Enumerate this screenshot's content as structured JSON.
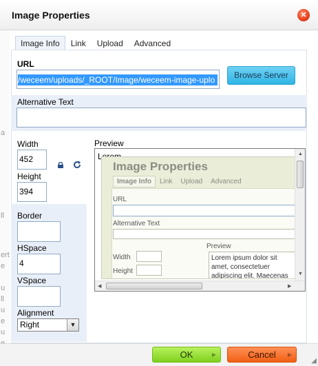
{
  "background_page": {
    "fragments": [
      "a",
      "ll",
      "ert",
      "e",
      "u",
      "ll",
      "u",
      "e",
      "u",
      "e",
      "a"
    ]
  },
  "dialog": {
    "title": "Image Properties",
    "close_icon": "close-icon"
  },
  "tabs": [
    {
      "label": "Image Info",
      "active": true
    },
    {
      "label": "Link",
      "active": false
    },
    {
      "label": "Upload",
      "active": false
    },
    {
      "label": "Advanced",
      "active": false
    }
  ],
  "form": {
    "url_label": "URL",
    "url_value": "/weceem/uploads/_ROOT/Image/weceem-image-uplo",
    "browse_label": "Browse Server",
    "alt_label": "Alternative Text",
    "alt_value": "",
    "width_label": "Width",
    "width_value": "452",
    "height_label": "Height",
    "height_value": "394",
    "border_label": "Border",
    "border_value": "",
    "hspace_label": "HSpace",
    "hspace_value": "4",
    "vspace_label": "VSpace",
    "vspace_value": "",
    "alignment_label": "Alignment",
    "alignment_value": "Right",
    "preview_label": "Preview"
  },
  "preview": {
    "text": "Lorem",
    "mini_title": "Image Properties",
    "mini_tabs": [
      "Image Info",
      "Link",
      "Upload",
      "Advanced"
    ],
    "mini_url_label": "URL",
    "mini_alt_label": "Alternative Text",
    "mini_width_label": "Width",
    "mini_height_label": "Height",
    "mini_preview_label": "Preview",
    "mini_lorem": "Lorem ipsum dolor sit amet, consectetuer adipiscing elit. Maecenas feugiat consequat diam."
  },
  "footer": {
    "ok_label": "OK",
    "cancel_label": "Cancel"
  },
  "colors": {
    "ok": "#7fd01e",
    "cancel": "#f15f14",
    "browse": "#2fb5e6",
    "close": "#e8401c"
  }
}
